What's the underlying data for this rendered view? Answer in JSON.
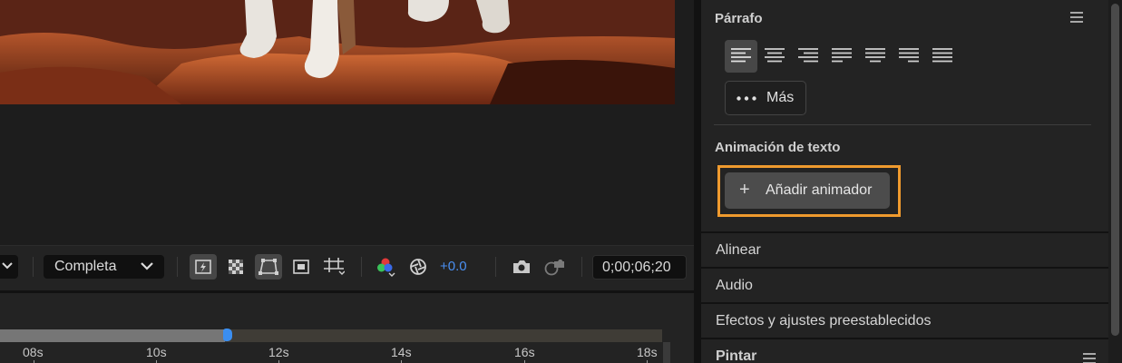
{
  "viewer": {
    "resolution_label": "Completa",
    "exposure_value": "+0.0",
    "timecode": "0;00;06;20"
  },
  "timeline": {
    "ruler_labels": [
      "08s",
      "10s",
      "12s",
      "14s",
      "16s",
      "18s"
    ],
    "progress_fraction": 0.34
  },
  "panel": {
    "paragraph": {
      "title": "Párrafo",
      "align_icons": [
        "align-left-icon",
        "align-center-icon",
        "align-right-icon",
        "justify-last-left-icon",
        "justify-last-center-icon",
        "justify-last-right-icon",
        "justify-all-icon"
      ],
      "more_label": "Más"
    },
    "text_animation": {
      "title": "Animación de texto",
      "add_animator_label": "Añadir animador",
      "highlight_color": "#ef9a2e"
    },
    "sections": [
      "Alinear",
      "Audio",
      "Efectos y ajustes preestablecidos",
      "Pintar"
    ]
  },
  "colors": {
    "accent_blue": "#3b8ef0",
    "exposure_blue": "#4a8ff0",
    "panel_bg": "#232323"
  }
}
